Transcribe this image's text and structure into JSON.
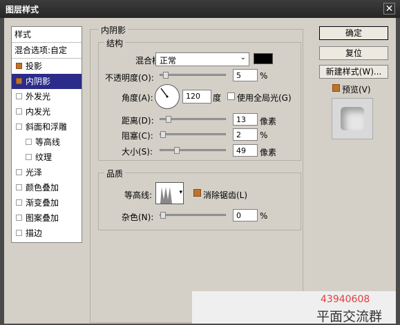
{
  "window": {
    "title": "图层样式"
  },
  "left": {
    "header": "样式",
    "blend_header": "混合选项:自定",
    "items": [
      {
        "label": "投影",
        "checked": true
      },
      {
        "label": "内阴影",
        "checked": true,
        "selected": true
      },
      {
        "label": "外发光"
      },
      {
        "label": "内发光"
      },
      {
        "label": "斜面和浮雕"
      },
      {
        "label": "等高线",
        "sub": true
      },
      {
        "label": "纹理",
        "sub": true
      },
      {
        "label": "光泽"
      },
      {
        "label": "颜色叠加"
      },
      {
        "label": "渐变叠加"
      },
      {
        "label": "图案叠加"
      },
      {
        "label": "描边"
      }
    ]
  },
  "main": {
    "group_title": "内阴影",
    "structure": {
      "title": "结构",
      "blend_mode_label": "混合模式:",
      "blend_mode_value": "正常",
      "blend_color": "#000000",
      "opacity_label": "不透明度(O):",
      "opacity_value": "5",
      "opacity_pct": 5,
      "opacity_unit": "%",
      "angle_label": "角度(A):",
      "angle_value": "120",
      "angle_unit": "度",
      "global_light_label": "使用全局光(G)",
      "distance_label": "距离(D):",
      "distance_value": "13",
      "distance_unit": "像素",
      "choke_label": "阻塞(C):",
      "choke_value": "2",
      "choke_unit": "%",
      "size_label": "大小(S):",
      "size_value": "49",
      "size_unit": "像素"
    },
    "quality": {
      "title": "品质",
      "contour_label": "等高线:",
      "antialias_label": "消除锯齿(L)",
      "noise_label": "杂色(N):",
      "noise_value": "0",
      "noise_unit": "%"
    }
  },
  "right": {
    "ok": "确定",
    "reset": "复位",
    "new_style": "新建样式(W)...",
    "preview_label": "预览(V)"
  },
  "watermark": {
    "number": "43940608",
    "text": "平面交流群"
  }
}
